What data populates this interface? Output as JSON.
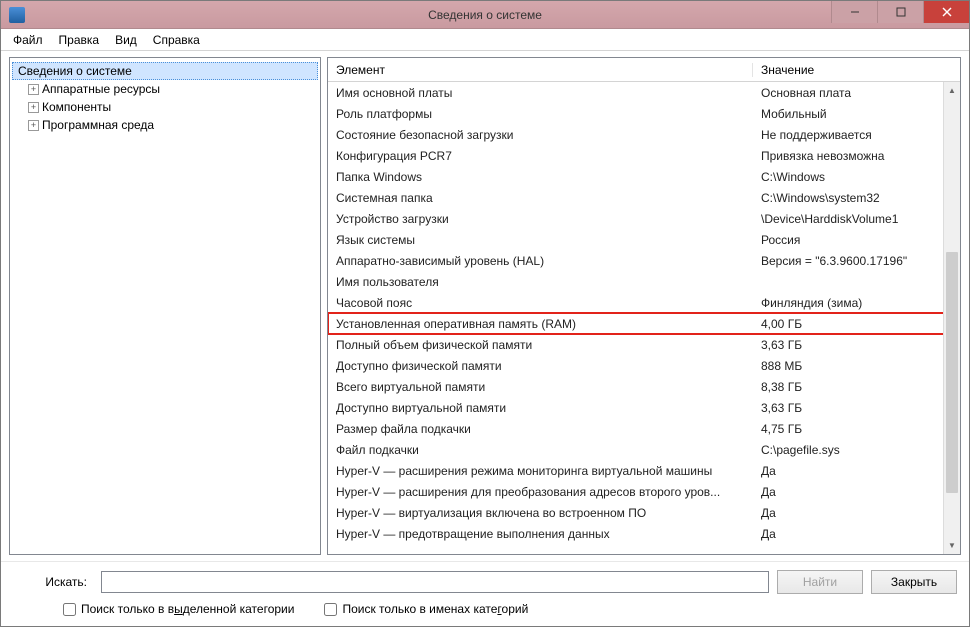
{
  "window": {
    "title": "Сведения о системе"
  },
  "menu": {
    "file": "Файл",
    "edit": "Правка",
    "view": "Вид",
    "help": "Справка"
  },
  "tree": {
    "root": "Сведения о системе",
    "items": [
      "Аппаратные ресурсы",
      "Компоненты",
      "Программная среда"
    ]
  },
  "table": {
    "col_element": "Элемент",
    "col_value": "Значение",
    "rows": [
      {
        "element": "Имя основной платы",
        "value": "Основная плата"
      },
      {
        "element": "Роль платформы",
        "value": "Мобильный"
      },
      {
        "element": "Состояние безопасной загрузки",
        "value": "Не поддерживается"
      },
      {
        "element": "Конфигурация PCR7",
        "value": "Привязка невозможна"
      },
      {
        "element": "Папка Windows",
        "value": "C:\\Windows"
      },
      {
        "element": "Системная папка",
        "value": "C:\\Windows\\system32"
      },
      {
        "element": "Устройство загрузки",
        "value": "\\Device\\HarddiskVolume1"
      },
      {
        "element": "Язык системы",
        "value": "Россия"
      },
      {
        "element": "Аппаратно-зависимый уровень (HAL)",
        "value": "Версия = \"6.3.9600.17196\""
      },
      {
        "element": "Имя пользователя",
        "value": ""
      },
      {
        "element": "Часовой пояс",
        "value": "Финляндия (зима)"
      },
      {
        "element": "Установленная оперативная память (RAM)",
        "value": "4,00 ГБ",
        "highlight": true
      },
      {
        "element": "Полный объем физической памяти",
        "value": "3,63 ГБ"
      },
      {
        "element": "Доступно физической памяти",
        "value": "888 МБ"
      },
      {
        "element": "Всего виртуальной памяти",
        "value": "8,38 ГБ"
      },
      {
        "element": "Доступно виртуальной памяти",
        "value": "3,63 ГБ"
      },
      {
        "element": "Размер файла подкачки",
        "value": "4,75 ГБ"
      },
      {
        "element": "Файл подкачки",
        "value": "C:\\pagefile.sys"
      },
      {
        "element": "Hyper-V — расширения режима мониторинга виртуальной машины",
        "value": "Да"
      },
      {
        "element": "Hyper-V — расширения для преобразования адресов второго уров...",
        "value": "Да"
      },
      {
        "element": "Hyper-V — виртуализация включена во встроенном ПО",
        "value": "Да"
      },
      {
        "element": "Hyper-V — предотвращение выполнения данных",
        "value": "Да"
      }
    ]
  },
  "footer": {
    "search_label": "Искать:",
    "find_button": "Найти",
    "close_button": "Закрыть",
    "check_selected_html": "Поиск только в в<span class='underline'>ы</span>деленной категории",
    "check_names_html": "Поиск только в именах кате<span class='underline'>г</span>орий"
  }
}
